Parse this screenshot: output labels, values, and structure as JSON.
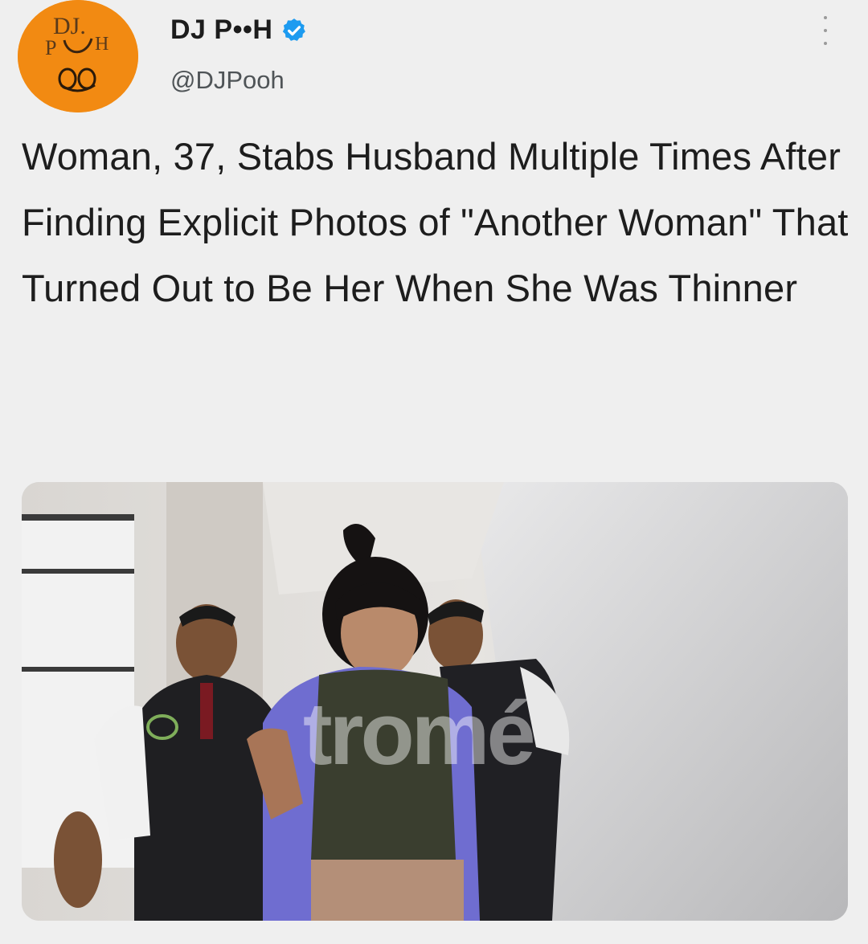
{
  "author": {
    "display_name": "DJ P••H",
    "handle": "@DJPooh",
    "avatar_logo_text": "DJ POOH",
    "avatar_color": "#f28a12",
    "verified": true,
    "verified_color": "#1d9bf0"
  },
  "tweet": {
    "text": "Woman, 37, Stabs Husband Multiple Times After Finding Explicit Photos of \"Another Woman\" That Turned Out to Be Her When She Was Thinner"
  },
  "media": {
    "watermark": "tromé"
  },
  "icons": {
    "more": "more-vertical-icon",
    "verified": "verified-badge-icon"
  }
}
